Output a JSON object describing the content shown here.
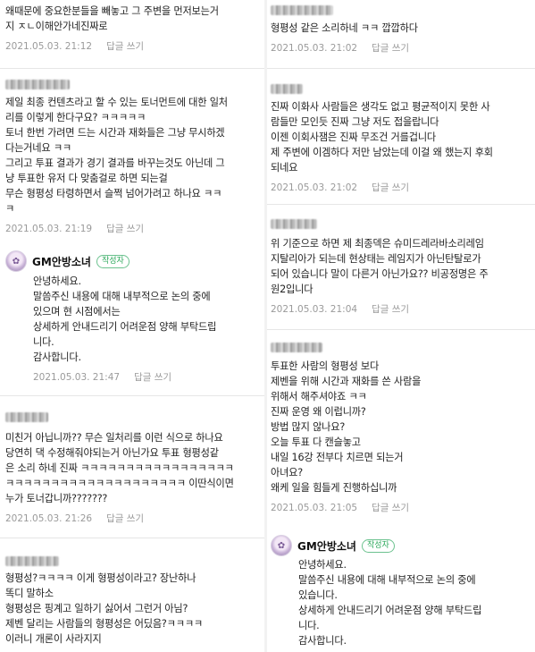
{
  "reply_label": "답글 쓰기",
  "author_badge": "작성자",
  "gm_name": "GM안방소녀",
  "left": [
    {
      "author_hidden": true,
      "lines": [
        "왜때문에 중요한분들을 빼놓고 그 주변을 먼저보는거",
        "지 ㅈㄴ이해안가네진짜로"
      ],
      "date": "2021.05.03. 21:12"
    },
    {
      "author_hidden": true,
      "lines": [
        "제일 최종 컨텐츠라고 할 수 있는 토너먼트에 대한 일처",
        "리를 이렇게 한다구요? ㅋㅋㅋㅋㅋ",
        "토너 한번 가려면 드는 시간과 재화들은 그냥 무시하겠",
        "다는거네요 ㅋㅋ",
        "그리고 투표 결과가 경기 결과를 바꾸는것도 아닌데 그",
        "냥 투표한 유저 다 맞춤걸로 하면 되는걸",
        "무슨 형평성 타령하면서 슬쩍 넘어가려고 하나요 ㅋㅋ",
        "ㅋ"
      ],
      "date": "2021.05.03. 21:19"
    },
    {
      "gm": true,
      "lines": [
        "안녕하세요.",
        "말씀주신 내용에 대해 내부적으로 논의 중에",
        "있으며 현 시점에서는",
        "상세하게 안내드리기 어려운점 양해 부탁드립",
        "니다.",
        "감사합니다."
      ],
      "date": "2021.05.03. 21:47"
    },
    {
      "author_hidden": true,
      "lines": [
        "미친거 아닙니까?? 무슨 일처리를 이런 식으로 하나요",
        "당연히 댁 수정해줘야되는거 아닌가요 투표 형평성같",
        "은 소리 하네 진짜 ㅋㅋㅋㅋㅋㅋㅋㅋㅋㅋㅋㅋㅋㅋㅋㅋㅋ",
        "ㅋㅋㅋㅋㅋㅋㅋㅋㅋㅋㅋㅋㅋㅋㅋㅋㅋㅋㅋㅋ 이딴식이면",
        "누가 토너갑니까???????"
      ],
      "date": "2021.05.03. 21:26"
    },
    {
      "author_hidden": true,
      "lines": [
        "형평성?ㅋㅋㅋㅋ 이게 형평성이라고? 장난하나",
        "똑디 말하소",
        "형평성은 핑계고 일하기 싫어서 그런거 아님?",
        "제벤 달리는 사람들의 형평성은 어딨음?ㅋㅋㅋㅋ",
        "이러니 개론이 사라지지"
      ],
      "date": ""
    }
  ],
  "right": [
    {
      "author_hidden": true,
      "lines": [
        "형평성 같은 소리하네 ㅋㅋ 깝깝하다"
      ],
      "date": "2021.05.03. 21:02"
    },
    {
      "author_hidden": true,
      "lines": [
        "진짜 이화사 사람들은 생각도 없고 평균적이지 못한 사",
        "람들만 모인듯 진짜 그냥 저도 접을랍니다",
        "이젠 이회사잼은 진짜 무조건 거를겁니다",
        "제 주변에 이겜하다 저만 남았는데 이걸 왜 했는지 후회",
        "되네요"
      ],
      "date": "2021.05.03. 21:02"
    },
    {
      "author_hidden": true,
      "lines": [
        "위 기준으로 하면 제 최종덱은 슈미드레라바소리레임",
        "지탈리아가 되는데 현상태는 레임지가 아닌탄탈로가",
        "되어 있습니다 말이 다른거 아닌가요?? 비공정명은 주",
        "원2입니다"
      ],
      "date": "2021.05.03. 21:04"
    },
    {
      "author_hidden": true,
      "lines": [
        "투표한 사람의 형평성 보다",
        "제벤을 위해 시간과 재화를 쓴 사람을",
        "위해서 해주셔야죠 ㅋㅋ",
        "진짜 운영 왜 이럽니까?",
        "방법 많지 않나요?",
        "오늘 투표 다 캔슬놓고",
        "내일 16강 전부다 치르면 되는거",
        "아녀요?",
        "왜케 일을 힘들게 진행하십니까"
      ],
      "date": "2021.05.03. 21:05"
    },
    {
      "gm": true,
      "lines": [
        "안녕하세요.",
        "말씀주신 내용에 대해 내부적으로 논의 중에",
        "있습니다.",
        "상세하게 안내드리기 어려운점 양해 부탁드립",
        "니다.",
        "감사합니다."
      ],
      "date": ""
    }
  ]
}
